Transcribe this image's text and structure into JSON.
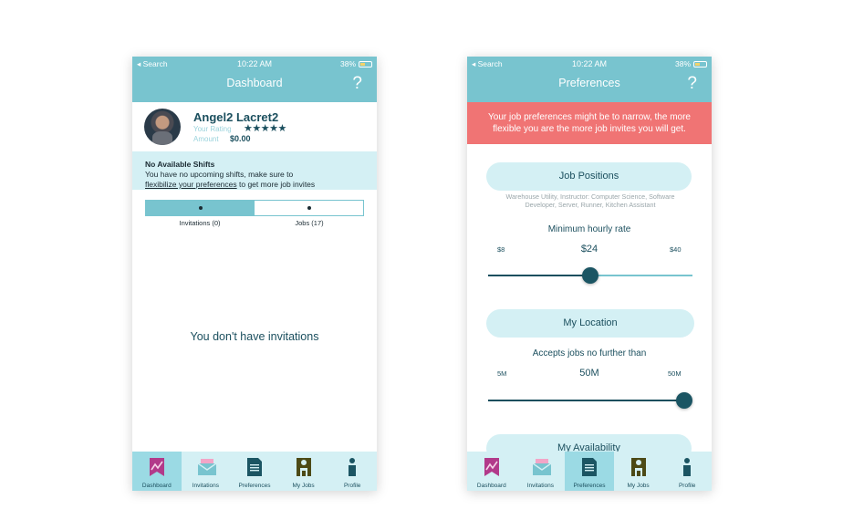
{
  "status_bar": {
    "carrier": "◂ Search",
    "time": "10:22 AM",
    "battery": "38%"
  },
  "left": {
    "title": "Dashboard",
    "help": "?",
    "profile": {
      "name": "Angel2 Lacret2",
      "rating_label": "Your Rating",
      "stars": "★★★★★",
      "amount_label": "Amount",
      "amount_value": "$0.00"
    },
    "notice": {
      "title": "No Available Shifts",
      "line1": "You have no upcoming shifts, make sure to",
      "link": "flexibilize your preferences",
      "line2_rest": " to get more job invites"
    },
    "tabs": [
      {
        "label": "Invitations (0)",
        "active": true
      },
      {
        "label": "Jobs (17)",
        "active": false
      }
    ],
    "empty_message": "You don't have invitations",
    "active_nav": 0
  },
  "right": {
    "title": "Preferences",
    "help": "?",
    "warning": "Your job preferences might be to narrow, the more flexible you are the more job invites you will get.",
    "job_positions": {
      "label": "Job Positions",
      "list": "Warehouse Utility, Instructor: Computer Science, Software Developer, Server, Runner, Kitchen Assistant"
    },
    "rate": {
      "label": "Minimum hourly rate",
      "min": "$8",
      "value": "$24",
      "max": "$40",
      "fraction": 0.5
    },
    "location": {
      "label": "My Location",
      "sub": "Accepts jobs no further than",
      "min": "5M",
      "value": "50M",
      "max": "50M",
      "fraction": 1.0
    },
    "availability": {
      "label": "My Availability"
    },
    "active_nav": 2
  },
  "nav": [
    {
      "label": "Dashboard",
      "icon": "dashboard-icon"
    },
    {
      "label": "Invitations",
      "icon": "envelope-icon"
    },
    {
      "label": "Preferences",
      "icon": "document-icon"
    },
    {
      "label": "My Jobs",
      "icon": "jobs-icon"
    },
    {
      "label": "Profile",
      "icon": "person-icon"
    }
  ],
  "colors": {
    "header": "#78c4cf",
    "dark_teal": "#1b4f5e",
    "light_bg": "#d4f0f4",
    "warning": "#f07474",
    "nav_active": "#9bdae4"
  }
}
